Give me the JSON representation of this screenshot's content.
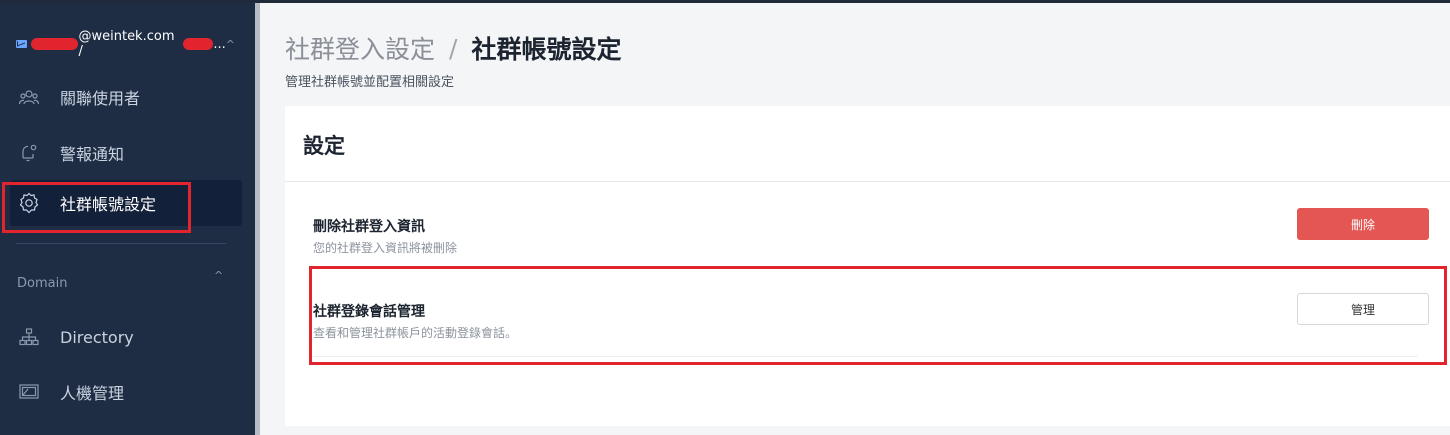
{
  "sidebar": {
    "account": {
      "email_visible": "@weintek.com /",
      "suffix": "...",
      "caret": "^"
    },
    "items": [
      {
        "label": "關聯使用者",
        "icon": "users-icon"
      },
      {
        "label": "警報通知",
        "icon": "bell-icon"
      },
      {
        "label": "社群帳號設定",
        "icon": "gear-icon"
      }
    ],
    "domain_section": {
      "title": "Domain",
      "caret": "^",
      "items": [
        {
          "label": "Directory",
          "icon": "sitemap-icon"
        },
        {
          "label": "人機管理",
          "icon": "monitor-icon"
        }
      ]
    }
  },
  "header": {
    "breadcrumb_parent": "社群登入設定",
    "breadcrumb_separator": "/",
    "breadcrumb_current": "社群帳號設定",
    "subtitle": "管理社群帳號並配置相關設定"
  },
  "card": {
    "title": "設定",
    "rows": [
      {
        "title": "刪除社群登入資訊",
        "description": "您的社群登入資訊將被刪除",
        "button": "刪除"
      },
      {
        "title": "社群登錄會話管理",
        "description": "查看和管理社群帳戶的活動登錄會話。",
        "button": "管理"
      }
    ]
  },
  "colors": {
    "sidebar_bg": "#1e2c44",
    "danger": "#e35654",
    "highlight": "#e2242f"
  }
}
